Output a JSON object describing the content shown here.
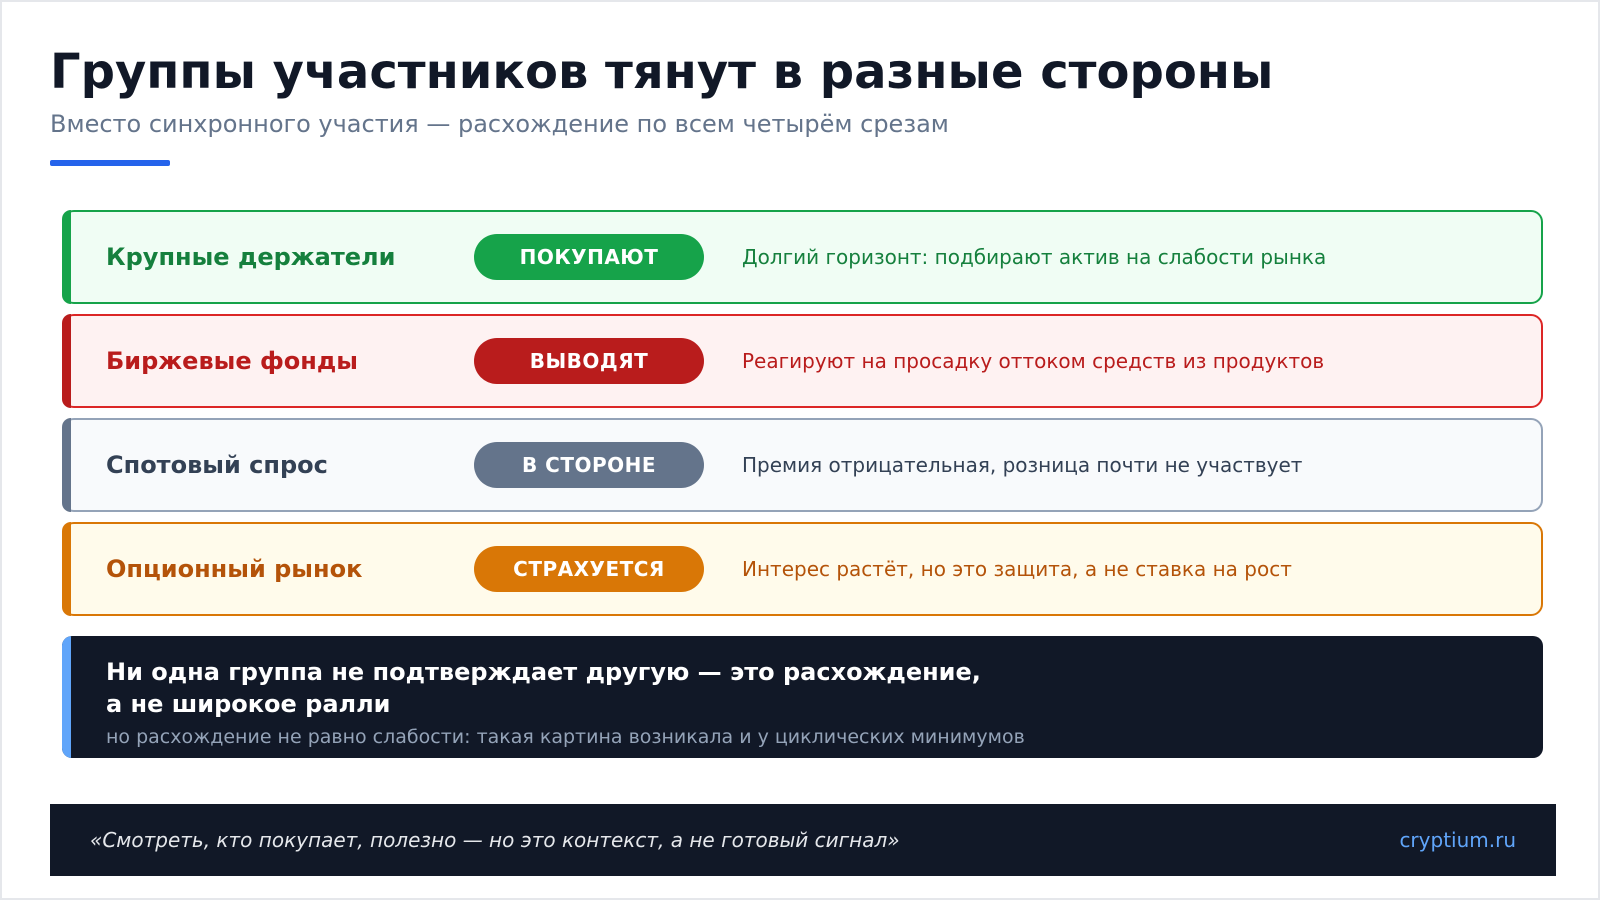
{
  "header": {
    "title": "Группы участников тянут в разные стороны",
    "subtitle": "Вместо синхронного участия — расхождение по всем четырём срезам",
    "accent_color": "#2563eb"
  },
  "rows": [
    {
      "group": "Крупные держатели",
      "status": "ПОКУПАЮТ",
      "description": "Долгий горизонт: подбирают актив на слабости рынка",
      "accent": "#16a34a",
      "text_color": "#15803d",
      "bg": "#f0fdf4",
      "border": "#16a34a"
    },
    {
      "group": "Биржевые фонды",
      "status": "ВЫВОДЯТ",
      "description": "Реагируют на просадку оттоком средств из продуктов",
      "accent": "#b91c1c",
      "text_color": "#b91c1c",
      "bg": "#fef2f2",
      "border": "#dc2626"
    },
    {
      "group": "Спотовый спрос",
      "status": "В СТОРОНЕ",
      "description": "Премия отрицательная, розница почти не участвует",
      "accent": "#64748b",
      "text_color": "#334155",
      "bg": "#f8fafc",
      "border": "#94a3b8"
    },
    {
      "group": "Опционный рынок",
      "status": "СТРАХУЕТСЯ",
      "description": "Интерес растёт, но это защита, а не ставка на рост",
      "accent": "#d97706",
      "text_color": "#b45309",
      "bg": "#fffbeb",
      "border": "#d97706"
    }
  ],
  "conclusion": {
    "main": "Ни одна группа не подтверждает другую — это расхождение,\nа не широкое ралли",
    "note": "но расхождение не равно слабости: такая картина возникала и у циклических минимумов",
    "accent_color": "#60a5fa"
  },
  "footer": {
    "quote": "«Смотреть, кто покупает, полезно — но это контекст, а не готовый сигнал»",
    "brand": "cryptium.ru",
    "brand_color": "#60a5fa"
  }
}
